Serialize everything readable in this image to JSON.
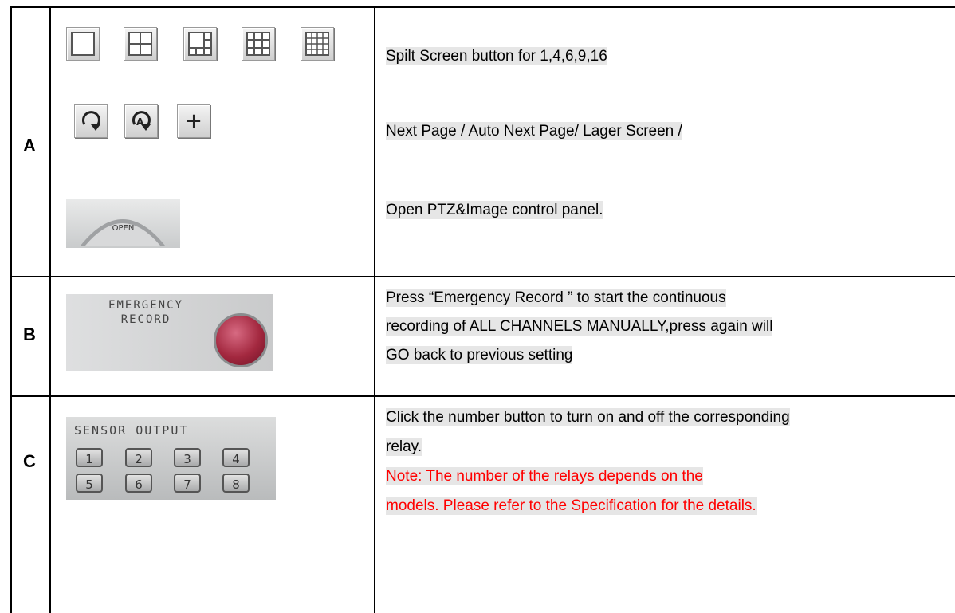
{
  "rows": {
    "a": {
      "label": "A",
      "split_description": "Spilt Screen button for 1,4,6,9,16",
      "nav_description": "Next Page / Auto Next Page/ Lager Screen /",
      "open_description": "Open PTZ&Image control panel.",
      "open_button_label": "OPEN",
      "larger_screen_label": "+"
    },
    "b": {
      "label": "B",
      "emergency_line1": "EMERGENCY",
      "emergency_line2": "RECORD",
      "description_lines": [
        "Press “Emergency Record ” to start the continuous",
        "recording of ALL CHANNELS MANUALLY,press again will",
        "GO back to previous setting"
      ]
    },
    "c": {
      "label": "C",
      "sensor_title": "SENSOR OUTPUT",
      "relay_buttons": [
        "1",
        "2",
        "3",
        "4",
        "5",
        "6",
        "7",
        "8"
      ],
      "description_lines": [
        "Click the number button to turn on and off the corresponding",
        "relay."
      ],
      "note_lines": [
        "Note: The number of the relays depends on the",
        "models. Please refer to the Specification for the details."
      ]
    }
  },
  "colors": {
    "note_text": "#ff0000",
    "highlight_bg": "#e6e6e6",
    "emergency_button": "#a3283f"
  },
  "icons": {
    "split_buttons": [
      "split-1-icon",
      "split-4-icon",
      "split-6-icon",
      "split-9-icon",
      "split-16-icon"
    ],
    "nav_buttons": [
      "next-page-icon",
      "auto-next-page-icon",
      "larger-screen-icon"
    ]
  }
}
